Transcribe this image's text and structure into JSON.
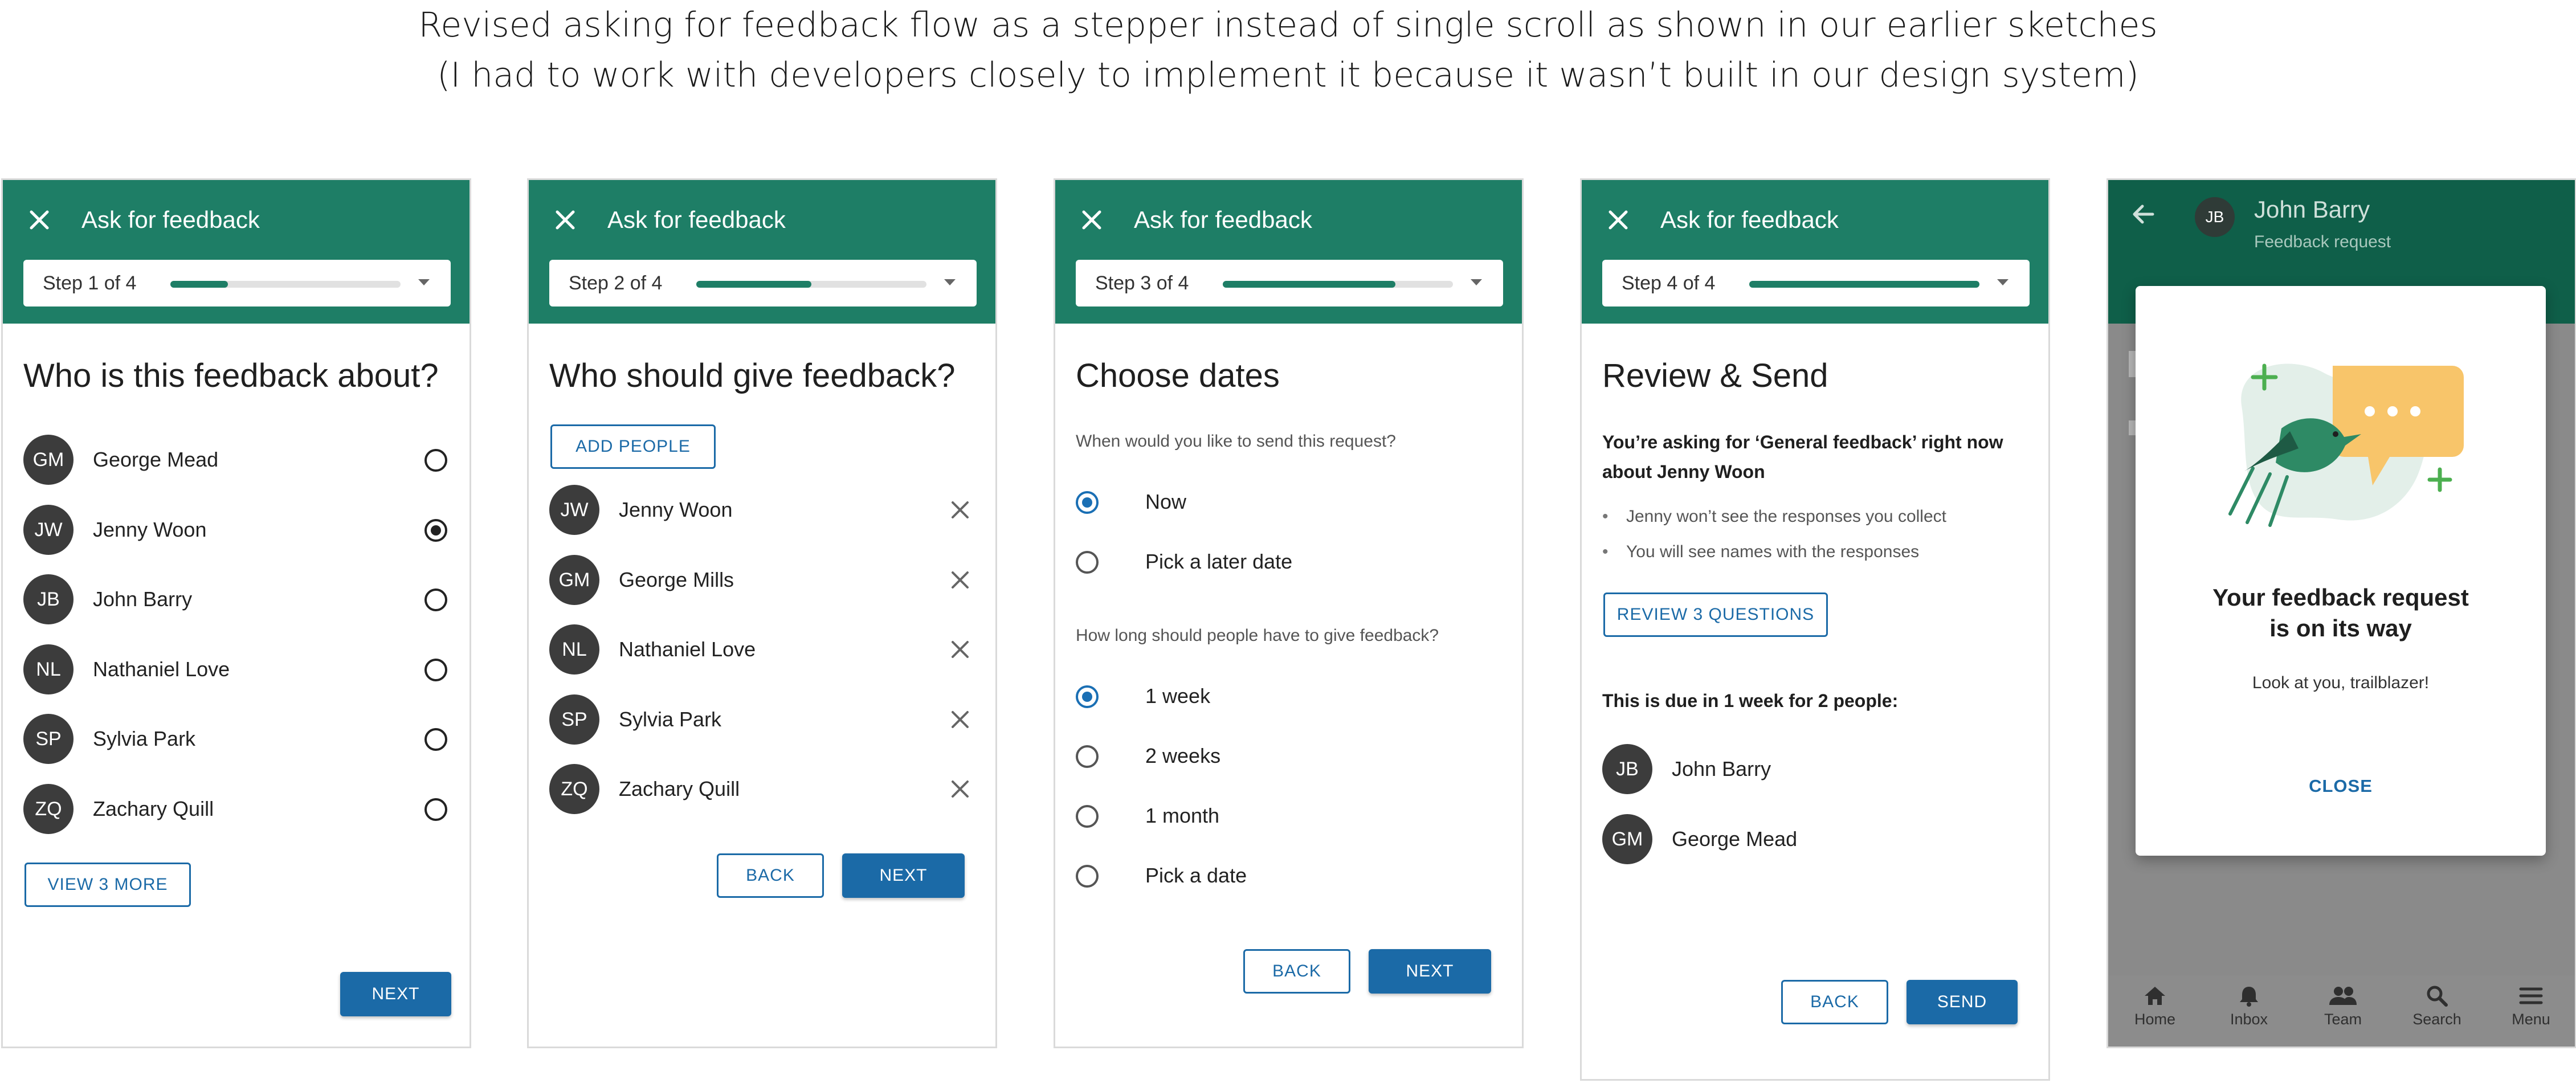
{
  "caption": {
    "line1": "Revised asking for feedback flow as a stepper instead of single scroll as shown in our earlier sketches",
    "line2": "(I had to work with developers closely to implement it because it wasn’t built in our design system)"
  },
  "colors": {
    "appbar": "#1e7e66",
    "primary": "#1b6aa7",
    "avatar": "#3c3c3c"
  },
  "appbar_title": "Ask for feedback",
  "screen1": {
    "step": "Step 1 of 4",
    "progress": 0.25,
    "heading": "Who is this feedback about?",
    "people": [
      {
        "initials": "GM",
        "name": "George Mead",
        "selected": false
      },
      {
        "initials": "JW",
        "name": "Jenny Woon",
        "selected": true
      },
      {
        "initials": "JB",
        "name": "John Barry",
        "selected": false
      },
      {
        "initials": "NL",
        "name": "Nathaniel Love",
        "selected": false
      },
      {
        "initials": "SP",
        "name": "Sylvia Park",
        "selected": false
      },
      {
        "initials": "ZQ",
        "name": "Zachary Quill",
        "selected": false
      }
    ],
    "view_more": "VIEW 3 MORE",
    "next": "NEXT"
  },
  "screen2": {
    "step": "Step 2 of 4",
    "progress": 0.5,
    "heading": "Who should give feedback?",
    "add_people": "ADD PEOPLE",
    "people": [
      {
        "initials": "JW",
        "name": "Jenny Woon"
      },
      {
        "initials": "GM",
        "name": "George Mills"
      },
      {
        "initials": "NL",
        "name": "Nathaniel Love"
      },
      {
        "initials": "SP",
        "name": "Sylvia Park"
      },
      {
        "initials": "ZQ",
        "name": "Zachary Quill"
      }
    ],
    "back": "BACK",
    "next": "NEXT"
  },
  "screen3": {
    "step": "Step 3 of 4",
    "progress": 0.75,
    "heading": "Choose dates",
    "q1": "When would you like to send this request?",
    "q1_options": [
      {
        "label": "Now",
        "selected": true
      },
      {
        "label": "Pick a later date",
        "selected": false
      }
    ],
    "q2": "How long should people have to give feedback?",
    "q2_options": [
      {
        "label": "1 week",
        "selected": true
      },
      {
        "label": "2 weeks",
        "selected": false
      },
      {
        "label": "1 month",
        "selected": false
      },
      {
        "label": "Pick a date",
        "selected": false
      }
    ],
    "back": "BACK",
    "next": "NEXT"
  },
  "screen4": {
    "step": "Step 4 of 4",
    "progress": 1.0,
    "heading": "Review & Send",
    "summary_line1": "You’re asking for ‘General feedback’ right now",
    "summary_line2": "about Jenny Woon",
    "bullets": [
      "Jenny won’t see the responses you collect",
      "You will see names with the responses"
    ],
    "review": "REVIEW 3 QUESTIONS",
    "due": "This is due in 1 week for 2 people:",
    "people": [
      {
        "initials": "JB",
        "name": "John Barry"
      },
      {
        "initials": "GM",
        "name": "George Mead"
      }
    ],
    "back": "BACK",
    "send": "SEND"
  },
  "screen5": {
    "avatar": "JB",
    "name": "John Barry",
    "subtitle": "Feedback request",
    "dialog_title_line1": "Your feedback request",
    "dialog_title_line2": "is on its way",
    "dialog_sub": "Look at you, trailblazer!",
    "dialog_close": "CLOSE",
    "nav": [
      {
        "label": "Home",
        "icon": "home-icon"
      },
      {
        "label": "Inbox",
        "icon": "bell-icon"
      },
      {
        "label": "Team",
        "icon": "people-icon"
      },
      {
        "label": "Search",
        "icon": "search-icon"
      },
      {
        "label": "Menu",
        "icon": "menu-icon"
      }
    ]
  }
}
